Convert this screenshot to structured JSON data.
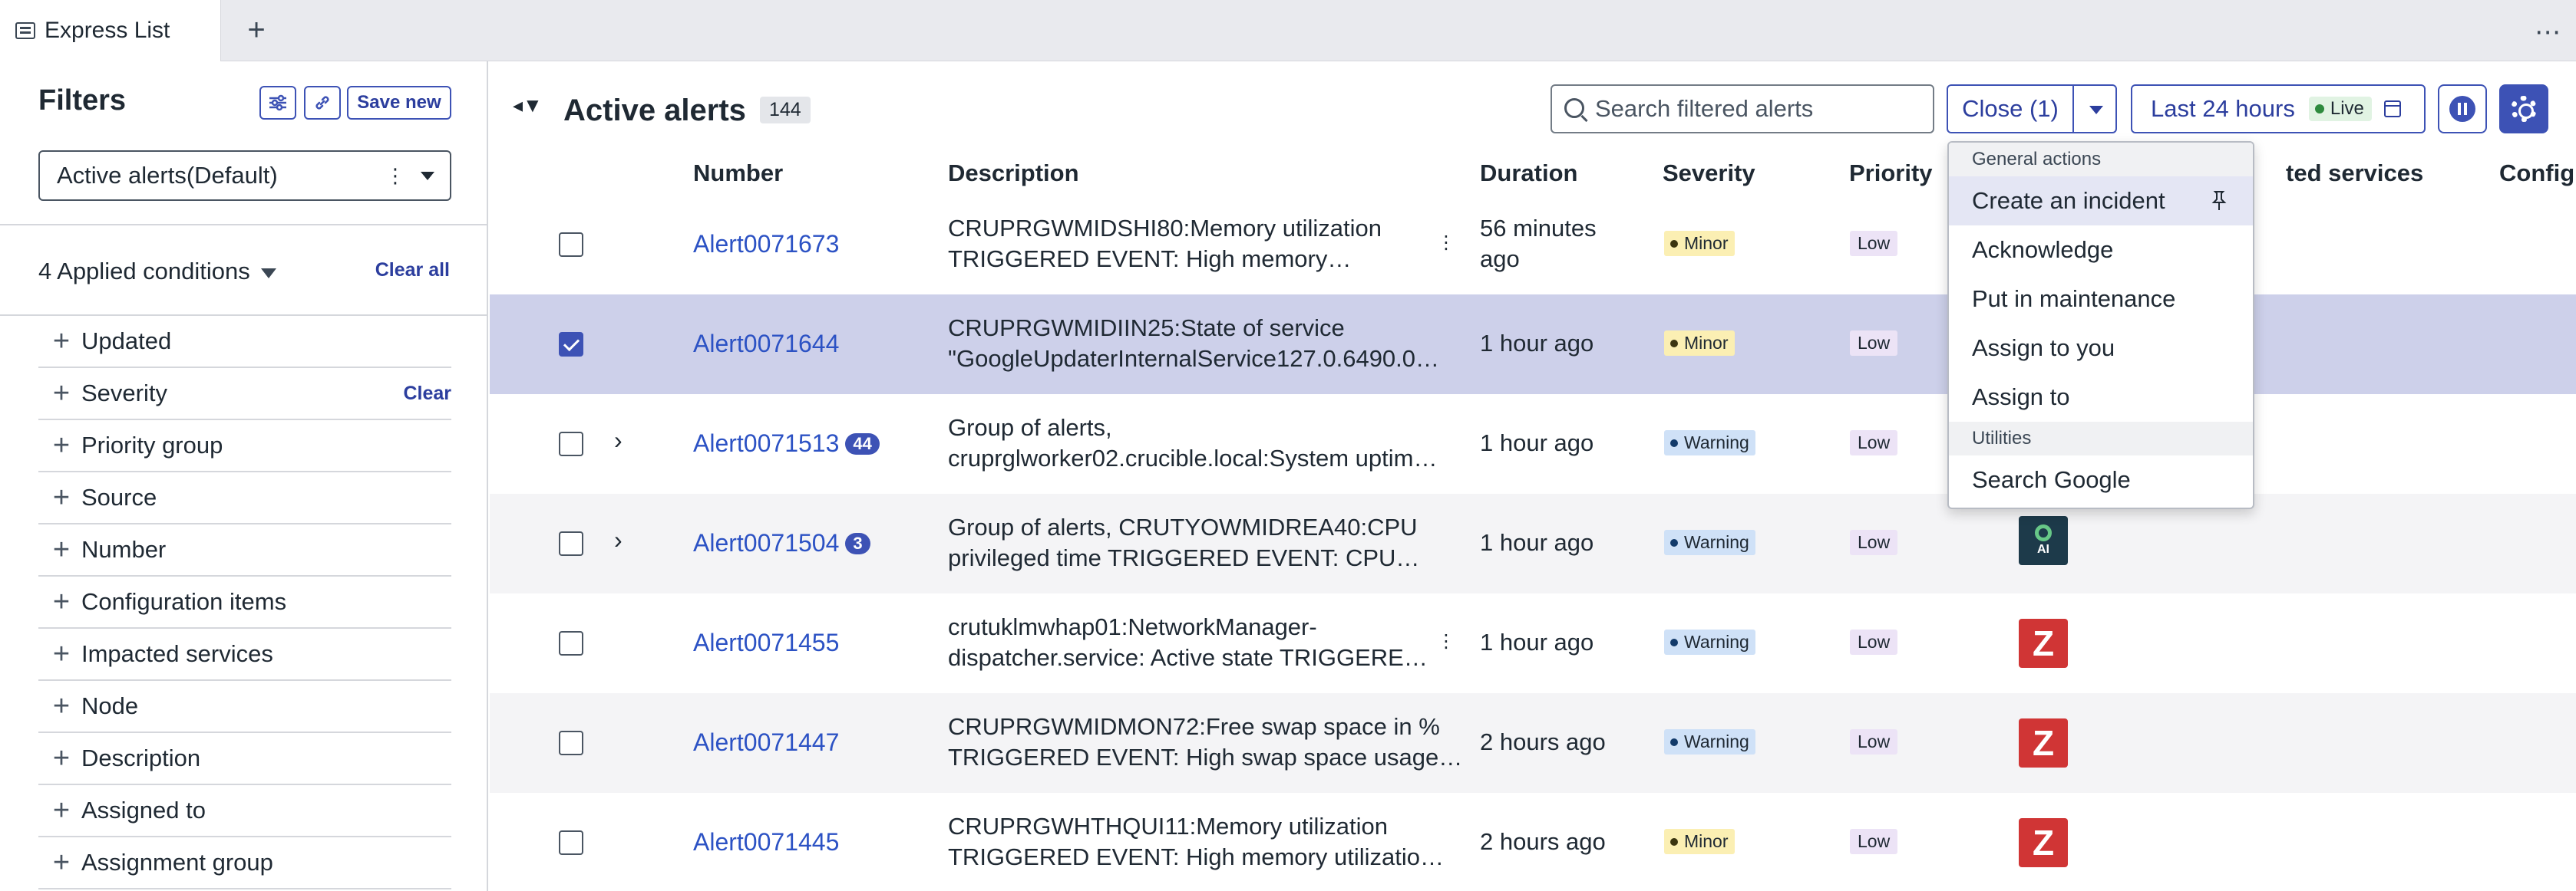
{
  "tabs": {
    "active_label": "Express List",
    "new_tab_glyph": "+",
    "more_glyph": "⋯"
  },
  "sidebar": {
    "title": "Filters",
    "save_new_label": "Save new",
    "view_select_value": "Active alerts(Default)",
    "applied_label": "4 Applied conditions",
    "clear_all_label": "Clear all",
    "conditions": [
      {
        "label": "Updated"
      },
      {
        "label": "Severity",
        "clear": "Clear"
      },
      {
        "label": "Priority group"
      },
      {
        "label": "Source"
      },
      {
        "label": "Number"
      },
      {
        "label": "Configuration items"
      },
      {
        "label": "Impacted services"
      },
      {
        "label": "Node"
      },
      {
        "label": "Description"
      },
      {
        "label": "Assigned to"
      },
      {
        "label": "Assignment group"
      }
    ]
  },
  "header": {
    "title": "Active alerts",
    "count": "144",
    "search_placeholder": "Search filtered alerts",
    "close_button_label": "Close (1)",
    "time_range_label": "Last 24 hours",
    "live_label": "Live"
  },
  "table": {
    "columns": {
      "number": "Number",
      "description": "Description",
      "duration": "Duration",
      "severity": "Severity",
      "priority": "Priority",
      "impacted_services_partial": "ted services",
      "config_partial": "Configu"
    },
    "rows": [
      {
        "number": "Alert0071673",
        "desc1": "CRUPRGWMIDSHI80:Memory utilization",
        "desc2": "TRIGGERED EVENT: High memory…",
        "duration1": "56 minutes",
        "duration2": "ago",
        "severity": "Minor",
        "priority": "Low",
        "checked": false,
        "expand": false,
        "badge": "",
        "source": "",
        "kebab": true
      },
      {
        "number": "Alert0071644",
        "desc1": "CRUPRGWMIDIIN25:State of service",
        "desc2": "\"GoogleUpdaterInternalService127.0.6490.0…",
        "duration1": "1 hour ago",
        "duration2": "",
        "severity": "Minor",
        "priority": "Low",
        "checked": true,
        "expand": false,
        "badge": "",
        "source": "",
        "kebab": false
      },
      {
        "number": "Alert0071513",
        "desc1": "Group of alerts,",
        "desc2": "cruprglworker02.crucible.local:System uptim…",
        "duration1": "1 hour ago",
        "duration2": "",
        "severity": "Warning",
        "priority": "Low",
        "checked": false,
        "expand": true,
        "badge": "44",
        "source": "",
        "kebab": false
      },
      {
        "number": "Alert0071504",
        "desc1": "Group of alerts, CRUTYOWMIDREA40:CPU",
        "desc2": "privileged time TRIGGERED EVENT: CPU…",
        "duration1": "1 hour ago",
        "duration2": "",
        "severity": "Warning",
        "priority": "Low",
        "checked": false,
        "expand": true,
        "badge": "3",
        "source": "AI",
        "kebab": false
      },
      {
        "number": "Alert0071455",
        "desc1": "crutuklmwhap01:NetworkManager-",
        "desc2": "dispatcher.service: Active state TRIGGERE…",
        "duration1": "1 hour ago",
        "duration2": "",
        "severity": "Warning",
        "priority": "Low",
        "checked": false,
        "expand": false,
        "badge": "",
        "source": "Z",
        "kebab": true
      },
      {
        "number": "Alert0071447",
        "desc1": "CRUPRGWMIDMON72:Free swap space in %",
        "desc2": "TRIGGERED EVENT: High swap space usage…",
        "duration1": "2 hours ago",
        "duration2": "",
        "severity": "Warning",
        "priority": "Low",
        "checked": false,
        "expand": false,
        "badge": "",
        "source": "Z",
        "kebab": false
      },
      {
        "number": "Alert0071445",
        "desc1": "CRUPRGWHTHQUI11:Memory utilization",
        "desc2": "TRIGGERED EVENT: High memory utilizatio…",
        "duration1": "2 hours ago",
        "duration2": "",
        "severity": "Minor",
        "priority": "Low",
        "checked": false,
        "expand": false,
        "badge": "",
        "source": "Z",
        "kebab": false
      }
    ]
  },
  "dropdown": {
    "group1": "General actions",
    "items1": [
      "Create an incident",
      "Acknowledge",
      "Put in maintenance",
      "Assign to you",
      "Assign to"
    ],
    "group2": "Utilities",
    "items2": [
      "Search Google"
    ]
  },
  "colors": {
    "accent": "#3d52b5",
    "link": "#2c52c4",
    "selected_row": "#cdd0ea",
    "minor": "#fbefb3",
    "warning": "#cfe1f7",
    "priority_low": "#ece3f6"
  }
}
